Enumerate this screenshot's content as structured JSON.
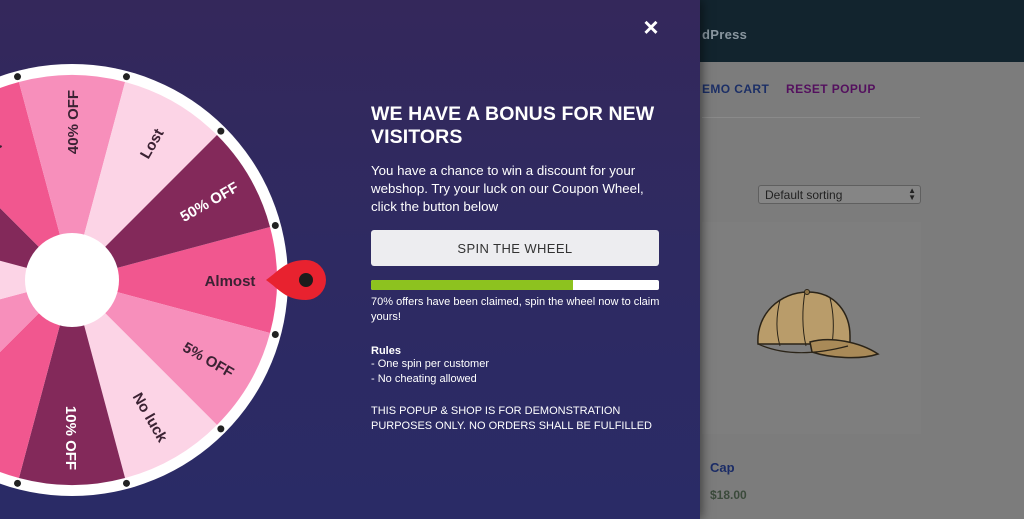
{
  "site": {
    "title_fragment": "dPress",
    "nav": {
      "demo_cart": "EMO CART",
      "reset_popup": "RESET POPUP"
    },
    "sort": {
      "selected": "Default sorting"
    },
    "product": {
      "name": "Cap",
      "price": "$18.00",
      "image_icon": "cap-icon"
    }
  },
  "popup": {
    "close_icon": "close-icon",
    "headline": "WE HAVE A BONUS FOR NEW VISITORS",
    "intro": "You have a chance to win a discount for your webshop. Try your luck on our Coupon Wheel, click the button below",
    "spin_button": "SPIN THE WHEEL",
    "progress_percent": 70,
    "progress_text": "70% offers have been claimed, spin the wheel now to claim yours!",
    "rules_title": "Rules",
    "rules": [
      "- One spin per customer",
      "- No cheating allowed"
    ],
    "disclaimer": "THIS POPUP & SHOP IS FOR DEMONSTRATION PURPOSES ONLY. NO ORDERS SHALL BE FULFILLED"
  },
  "wheel": {
    "slices": [
      {
        "label": "Almost",
        "color": "#f1578f"
      },
      {
        "label": "5% OFF",
        "color": "#f78fbb"
      },
      {
        "label": "No luck",
        "color": "#fcd4e6"
      },
      {
        "label": "10% OFF",
        "color": "#83295a"
      },
      {
        "label": "",
        "color": "#f1578f"
      },
      {
        "label": "",
        "color": "#f78fbb"
      },
      {
        "label": "",
        "color": "#fcd4e6"
      },
      {
        "label": "",
        "color": "#83295a"
      },
      {
        "label": "Try",
        "color": "#f1578f"
      },
      {
        "label": "40% OFF",
        "color": "#f78fbb"
      },
      {
        "label": "Lost",
        "color": "#fcd4e6"
      },
      {
        "label": "50% OFF",
        "color": "#83295a"
      }
    ],
    "label_colors": {
      "dark_text": "#3b2233",
      "light_text": "#ffffff"
    },
    "pointer_color": "#e8222f"
  }
}
